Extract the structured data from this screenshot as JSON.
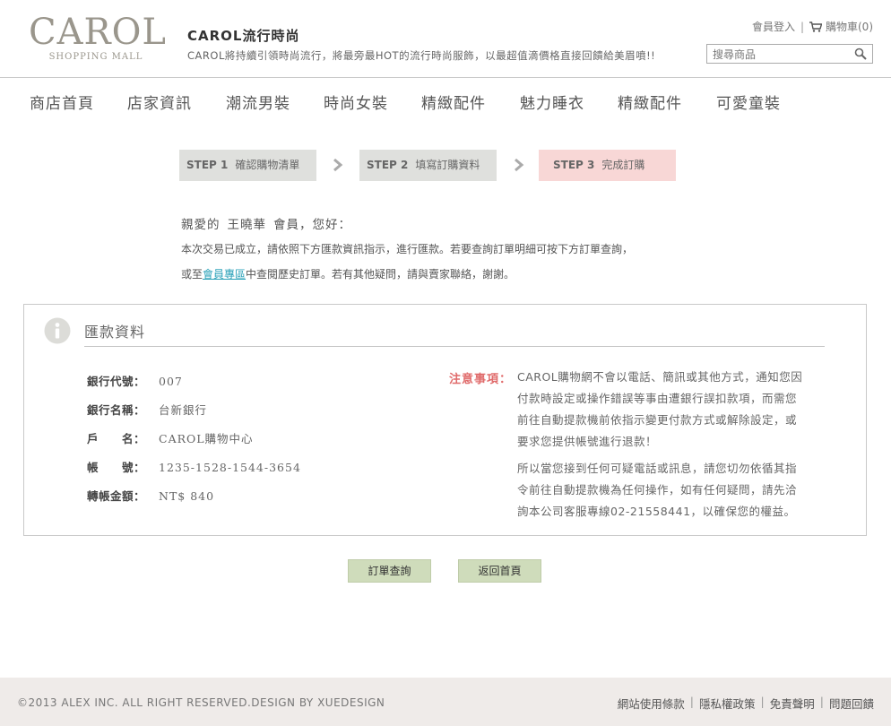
{
  "header": {
    "logo_main": "CAROL",
    "logo_sub": "SHOPPING MALL",
    "brand_title": "CAROL流行時尚",
    "slogan": "CAROL將持續引領時尚流行，將最旁最HOT的流行時尚服飾，以最超值滴價格直接回饋給美眉噴!!",
    "login_label": "會員登入",
    "cart_label": "購物車(0)",
    "search_placeholder": "搜尋商品"
  },
  "nav": {
    "items": [
      "商店首頁",
      "店家資訊",
      "潮流男裝",
      "時尚女裝",
      "精緻配件",
      "魅力睡衣",
      "精緻配件",
      "可愛童裝"
    ]
  },
  "steps": [
    {
      "num": "STEP 1",
      "label": "確認購物清單"
    },
    {
      "num": "STEP 2",
      "label": "填寫訂購資料"
    },
    {
      "num": "STEP 3",
      "label": "完成訂購"
    }
  ],
  "greeting": {
    "prefix": "親愛的",
    "name": "王曉華",
    "suffix": "會員，您好：",
    "line1": "本次交易已成立，請依照下方匯款資訊指示，進行匯款。若要查詢訂單明細可按下方訂單查詢，",
    "line2_pre": "或至",
    "line2_link": "會員專區",
    "line2_post": "中查閱歷史訂單。若有其他疑問，請與賣家聯絡，謝謝。"
  },
  "remit": {
    "title": "匯款資料",
    "rows": [
      {
        "label": "銀行代號：",
        "value": "007"
      },
      {
        "label": "銀行名稱：",
        "value": "台新銀行"
      },
      {
        "label": "戶　　名：",
        "value": "CAROL購物中心"
      },
      {
        "label": "帳　　號：",
        "value": "1235-1528-1544-3654"
      },
      {
        "label": "轉帳金額：",
        "value": "NT$ 840"
      }
    ],
    "note_label": "注意事項：",
    "note_p1_lines": [
      "CAROL購物網不會以電話、簡訊或其他方式，通知您因",
      "付款時設定或操作錯誤等事由遭銀行誤扣款項，而需您",
      "前往自動提款機前依指示變更付款方式或解除設定，或",
      "要求您提供帳號進行退款！"
    ],
    "note_p2_lines": [
      "所以當您接到任何可疑電話或訊息，請您切勿依循其指",
      "令前往自動提款機為任何操作，如有任何疑問，請先洽",
      "詢本公司客服專線02-21558441，以確保您的權益。"
    ]
  },
  "buttons": {
    "order_query": "訂單查詢",
    "back_home": "返回首頁"
  },
  "footer": {
    "copyright": "©2013 ALEX INC. ALL RIGHT RESERVED.DESIGN BY XUEDESIGN",
    "links": [
      "網站使用條款",
      "隱私權政策",
      "免責聲明",
      "問題回饋"
    ]
  },
  "colors": {
    "step_active": "#f8d7d6",
    "step_inactive": "#dfe0dd",
    "button": "#cfdcbb",
    "note_red": "#e06b6b",
    "link": "#2aa1b8",
    "footer_bg": "#efebe9"
  },
  "icons": {
    "cart": "cart-icon",
    "search": "search-icon",
    "info": "info-icon",
    "step_arrow": "chevron-right-icon"
  }
}
